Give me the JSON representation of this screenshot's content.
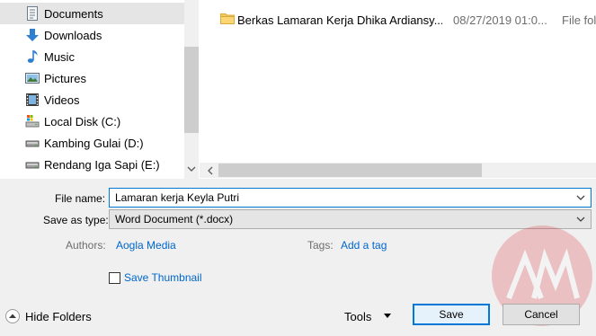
{
  "nav": {
    "items": [
      {
        "label": "Documents",
        "icon": "documents-icon",
        "selected": true
      },
      {
        "label": "Downloads",
        "icon": "downloads-icon"
      },
      {
        "label": "Music",
        "icon": "music-icon"
      },
      {
        "label": "Pictures",
        "icon": "pictures-icon"
      },
      {
        "label": "Videos",
        "icon": "videos-icon"
      },
      {
        "label": "Local Disk (C:)",
        "icon": "local-disk-icon"
      },
      {
        "label": "Kambing Gulai (D:)",
        "icon": "drive-icon"
      },
      {
        "label": "Rendang Iga Sapi (E:)",
        "icon": "drive-icon"
      }
    ]
  },
  "files": [
    {
      "name": "Berkas Lamaran Kerja Dhika Ardiansy...",
      "date": "08/27/2019 01:0...",
      "type": "File fol",
      "icon": "folder-icon"
    }
  ],
  "form": {
    "filename_label": "File name:",
    "filename_value": "Lamaran kerja Keyla Putri",
    "savetype_label": "Save as type:",
    "savetype_value": "Word Document (*.docx)",
    "authors_label": "Authors:",
    "authors_value": "Aogla Media",
    "tags_label": "Tags:",
    "tags_value": "Add a tag",
    "thumbnail_label": "Save Thumbnail",
    "thumbnail_checked": false
  },
  "footer": {
    "hide_folders": "Hide Folders",
    "tools": "Tools",
    "save": "Save",
    "cancel": "Cancel"
  },
  "watermark": {
    "text": "AM",
    "icon": "watermark-logo"
  },
  "colors": {
    "accent": "#0078d7",
    "link": "#0066cc",
    "selected": "#e5e5e5",
    "watermark": "#d81b2a"
  }
}
